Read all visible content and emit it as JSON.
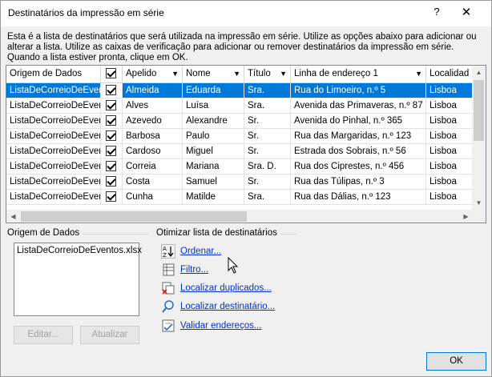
{
  "window": {
    "title": "Destinatários da impressão em série",
    "help": "?",
    "close": "✕"
  },
  "intro": "Esta é a lista de destinatários que será utilizada na impressão em série. Utilize as opções abaixo para adicionar ou alterar a lista. Utilize as caixas de verificação para adicionar ou remover destinatários da impressão em série. Quando a lista estiver pronta, clique em OK.",
  "grid": {
    "columns": [
      "Origem de Dados",
      "",
      "Apelido",
      "Nome",
      "Título",
      "Linha de endereço 1",
      "Localidad"
    ],
    "rows": [
      [
        "ListaDeCorreioDeEventos.xlsx",
        "",
        "Almeida",
        "Eduarda",
        "Sra.",
        "Rua do Limoeiro, n.º 5",
        "Lisboa"
      ],
      [
        "ListaDeCorreioDeEventos.xlsx",
        "",
        "Alves",
        "Luísa",
        "Sra.",
        "Avenida das Primaveras, n.º 87",
        "Lisboa"
      ],
      [
        "ListaDeCorreioDeEventos.xlsx",
        "",
        "Azevedo",
        "Alexandre",
        "Sr.",
        "Avenida do Pinhal, n.º 365",
        "Lisboa"
      ],
      [
        "ListaDeCorreioDeEventos.xlsx",
        "",
        "Barbosa",
        "Paulo",
        "Sr.",
        "Rua das Margaridas, n.º 123",
        "Lisboa"
      ],
      [
        "ListaDeCorreioDeEventos.xlsx",
        "",
        "Cardoso",
        "Miguel",
        "Sr.",
        "Estrada dos Sobrais, n.º 56",
        "Lisboa"
      ],
      [
        "ListaDeCorreioDeEventos.xlsx",
        "",
        "Correia",
        "Mariana",
        "Sra. D.",
        "Rua dos Ciprestes, n.º 456",
        "Lisboa"
      ],
      [
        "ListaDeCorreioDeEventos.xlsx",
        "",
        "Costa",
        "Samuel",
        "Sr.",
        "Rua das Túlipas, n.º 3",
        "Lisboa"
      ],
      [
        "ListaDeCorreioDeEventos.xlsx",
        "",
        "Cunha",
        "Matilde",
        "Sra.",
        "Rua das Dálias, n.º 123",
        "Lisboa"
      ]
    ]
  },
  "datasource": {
    "label": "Origem de Dados",
    "item": "ListaDeCorreioDeEventos.xlsx",
    "edit": "Editar...",
    "refresh": "Atualizar"
  },
  "refine": {
    "label": "Otimizar lista de destinatários",
    "sort": "Ordenar...",
    "filter": "Filtro...",
    "duplicates": "Localizar duplicados...",
    "find": "Localizar destinatário...",
    "validate": "Validar endereços..."
  },
  "ok": "OK"
}
